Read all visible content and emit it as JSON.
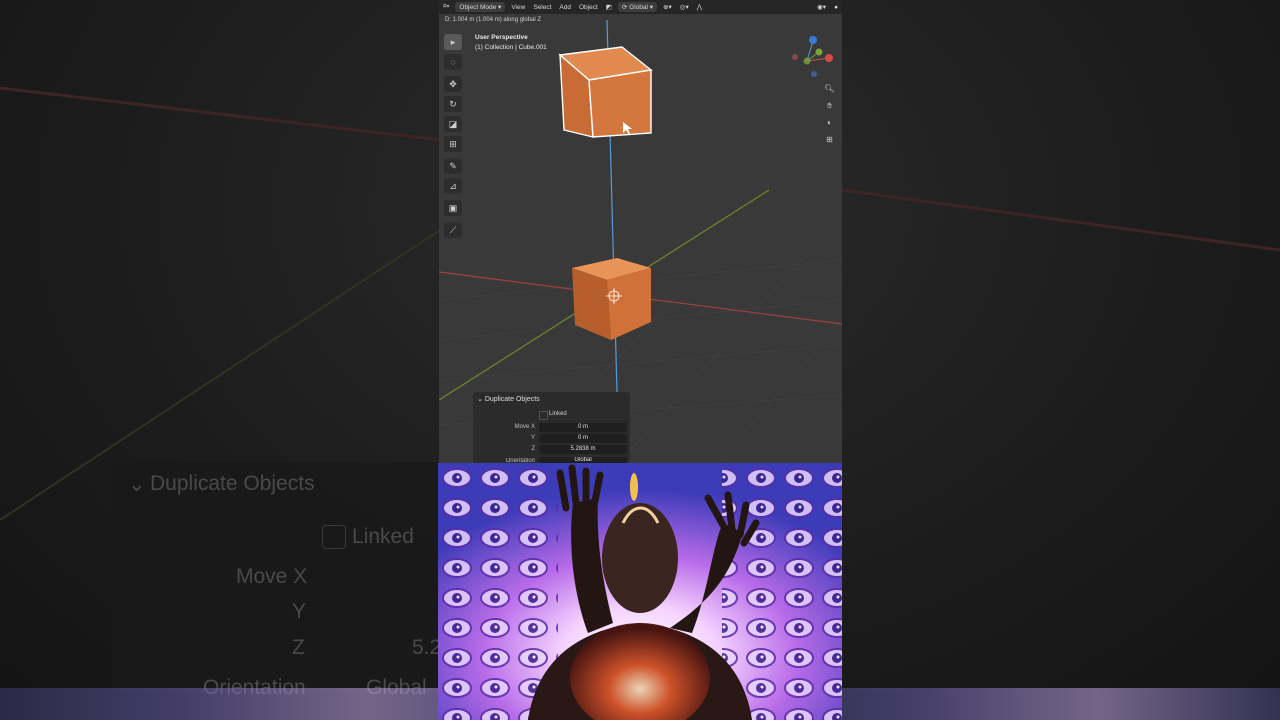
{
  "viewport": {
    "status_text": "D: 1.004 m (1.004 m) along global Z",
    "perspective_title": "User Perspective",
    "perspective_subtitle": "(1) Collection | Cube.001"
  },
  "topbar": {
    "mode": "Object Mode",
    "menus": [
      "View",
      "Select",
      "Add",
      "Object"
    ],
    "orientation": "Global"
  },
  "toolbar_icons": [
    "select-box-icon",
    "cursor-icon",
    "move-icon",
    "rotate-icon",
    "scale-icon",
    "transform-icon",
    "annotate-icon",
    "measure-icon",
    "add-cube-icon",
    "brush-icon"
  ],
  "navigation_icons": [
    "zoom-icon",
    "hand-pan-icon",
    "camera-icon",
    "grid-icon"
  ],
  "operator_panel": {
    "title": "Duplicate Objects",
    "linked_label": "Linked",
    "linked": false,
    "move_x_label": "Move X",
    "move_x": "0 m",
    "y_label": "Y",
    "move_y": "0 m",
    "z_label": "Z",
    "move_z": "5.2838 m",
    "orientation_label": "Orientation",
    "orientation_value": "Global"
  },
  "background_copy": {
    "title": "Duplicate Objects",
    "linked_label": "Linked",
    "move_x_label": "Move X",
    "y_label": "Y",
    "z_label": "Z",
    "z_value": "5.2",
    "orientation_label": "Orientation",
    "orientation_value": "Global"
  },
  "colors": {
    "cube": "#d6773f",
    "viewport_bg": "#393939",
    "axis_x": "#a34141",
    "axis_y": "#6f8a2a",
    "axis_z": "#5a9bd5"
  }
}
